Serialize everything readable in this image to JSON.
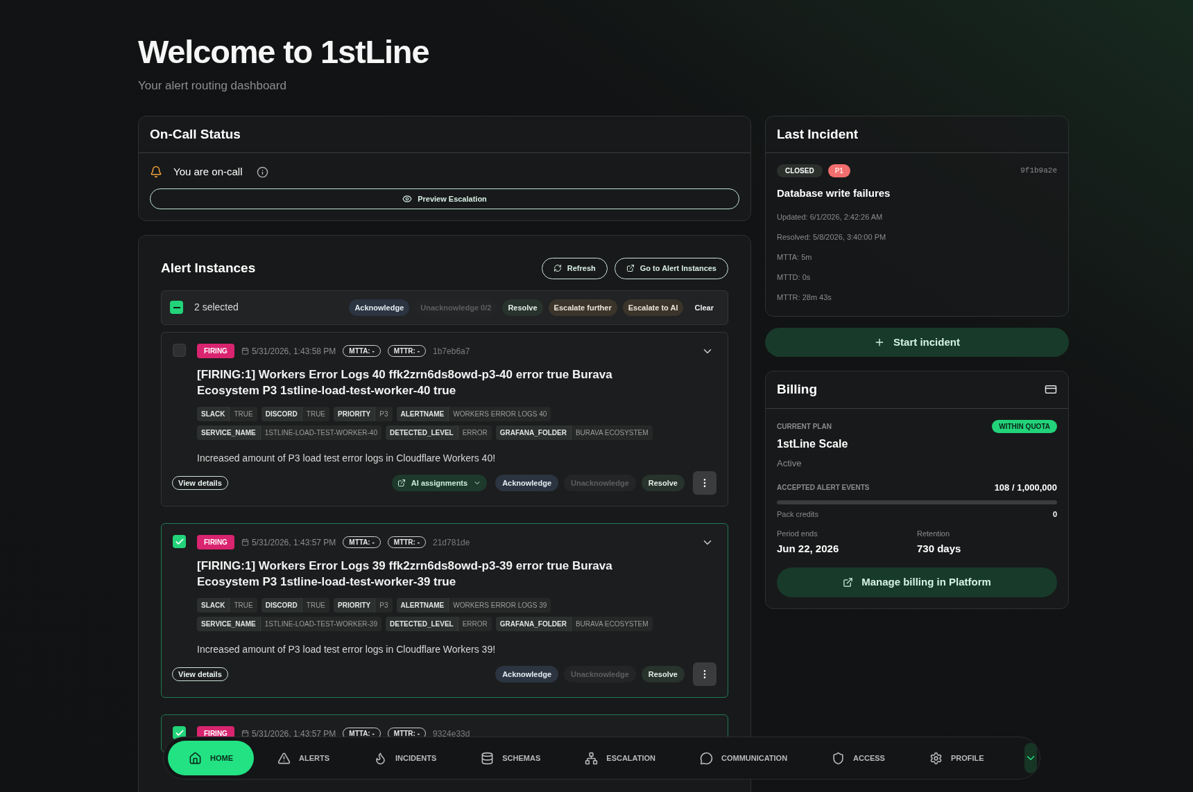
{
  "header": {
    "title": "Welcome to 1stLine",
    "subtitle": "Your alert routing dashboard"
  },
  "on_call": {
    "title": "On-Call Status",
    "status": "You are on-call",
    "preview_button": "Preview Escalation"
  },
  "alert_instances": {
    "title": "Alert Instances",
    "buttons": [
      "Refresh",
      "Go to Alert Instances"
    ],
    "selection": {
      "checked": true,
      "label": "2 selected",
      "actions": [
        {
          "label": "Acknowledge",
          "kind": "ack",
          "disabled": false
        },
        {
          "label": "Unacknowledge 0/2",
          "kind": "ack",
          "disabled": true
        },
        {
          "label": "Resolve",
          "kind": "resolve",
          "disabled": false
        },
        {
          "label": "Escalate further",
          "kind": "escalate",
          "disabled": false
        },
        {
          "label": "Escalate to AI",
          "kind": "escalate",
          "disabled": false
        },
        {
          "label": "Clear",
          "kind": "plain",
          "disabled": false
        }
      ]
    },
    "alerts": [
      {
        "selected": false,
        "status": "FIRING",
        "time": "5/31/2026, 1:43:58 PM",
        "mtta": "MTTA: -",
        "mttr": "MTTR: -",
        "id": "1b7eb6a7",
        "title": "[FIRING:1] Workers Error Logs 40 ffk2zrn6ds8owd-p3-40 error true Burava Ecosystem P3 1stline-load-test-worker-40 true",
        "labels": [
          {
            "key": "SLACK",
            "value": "TRUE"
          },
          {
            "key": "DISCORD",
            "value": "TRUE"
          },
          {
            "key": "PRIORITY",
            "value": "P3"
          },
          {
            "key": "ALERTNAME",
            "value": "WORKERS ERROR LOGS 40"
          },
          {
            "key": "SERVICE_NAME",
            "value": "1STLINE-LOAD-TEST-WORKER-40"
          },
          {
            "key": "DETECTED_LEVEL",
            "value": "ERROR"
          },
          {
            "key": "GRAFANA_FOLDER",
            "value": "BURAVA ECOSYSTEM"
          }
        ],
        "description": "Increased amount of P3 load test error logs in Cloudflare Workers 40!",
        "view_details": "View details",
        "ai_assignments": "AI assignments",
        "actions": [
          {
            "label": "Acknowledge",
            "kind": "ack",
            "disabled": false
          },
          {
            "label": "Unacknowledge",
            "kind": "ack",
            "disabled": true
          },
          {
            "label": "Resolve",
            "kind": "resolve",
            "disabled": false
          }
        ]
      },
      {
        "selected": true,
        "status": "FIRING",
        "time": "5/31/2026, 1:43:57 PM",
        "mtta": "MTTA: -",
        "mttr": "MTTR: -",
        "id": "21d781de",
        "title": "[FIRING:1] Workers Error Logs 39 ffk2zrn6ds8owd-p3-39 error true Burava Ecosystem P3 1stline-load-test-worker-39 true",
        "labels": [
          {
            "key": "SLACK",
            "value": "TRUE"
          },
          {
            "key": "DISCORD",
            "value": "TRUE"
          },
          {
            "key": "PRIORITY",
            "value": "P3"
          },
          {
            "key": "ALERTNAME",
            "value": "WORKERS ERROR LOGS 39"
          },
          {
            "key": "SERVICE_NAME",
            "value": "1STLINE-LOAD-TEST-WORKER-39"
          },
          {
            "key": "DETECTED_LEVEL",
            "value": "ERROR"
          },
          {
            "key": "GRAFANA_FOLDER",
            "value": "BURAVA ECOSYSTEM"
          }
        ],
        "description": "Increased amount of P3 load test error logs in Cloudflare Workers 39!",
        "view_details": "View details",
        "actions": [
          {
            "label": "Acknowledge",
            "kind": "ack",
            "disabled": false
          },
          {
            "label": "Unacknowledge",
            "kind": "ack",
            "disabled": true
          },
          {
            "label": "Resolve",
            "kind": "resolve",
            "disabled": false
          }
        ]
      },
      {
        "selected": true,
        "status": "FIRING",
        "time": "5/31/2026, 1:43:57 PM",
        "mtta": "MTTA: -",
        "mttr": "MTTR: -",
        "id": "9324e33d"
      }
    ]
  },
  "last_incident": {
    "title": "Last Incident",
    "status": "CLOSED",
    "priority": "P1",
    "id": "9f1b9a2e",
    "name": "Database write failures",
    "details": [
      "Updated: 6/1/2026, 2:42:26 AM",
      "Resolved: 5/8/2026, 3:40:00 PM",
      "MTTA: 5m",
      "MTTD: 0s",
      "MTTR: 28m 43s"
    ]
  },
  "start_incident": "Start incident",
  "billing": {
    "title": "Billing",
    "plan_label": "CURRENT PLAN",
    "quota": "WITHIN QUOTA",
    "plan": "1stLine Scale",
    "plan_status": "Active",
    "events_label": "ACCEPTED ALERT EVENTS",
    "events_value": "108 / 1,000,000",
    "level": 0.0001,
    "credits_label": "Pack credits",
    "credits_value": "0",
    "period_label": "Period ends",
    "period_value": "Jun 22, 2026",
    "retention_label": "Retention",
    "retention_value": "730 days",
    "manage_button": "Manage billing in Platform"
  },
  "nav": [
    {
      "label": "HOME",
      "selected": true
    },
    {
      "label": "ALERTS",
      "selected": false
    },
    {
      "label": "INCIDENTS",
      "selected": false
    },
    {
      "label": "SCHEMAS",
      "selected": false
    },
    {
      "label": "ESCALATION",
      "selected": false
    },
    {
      "label": "COMMUNICATION",
      "selected": false
    },
    {
      "label": "ACCESS",
      "selected": false
    },
    {
      "label": "PROFILE",
      "selected": false
    }
  ]
}
